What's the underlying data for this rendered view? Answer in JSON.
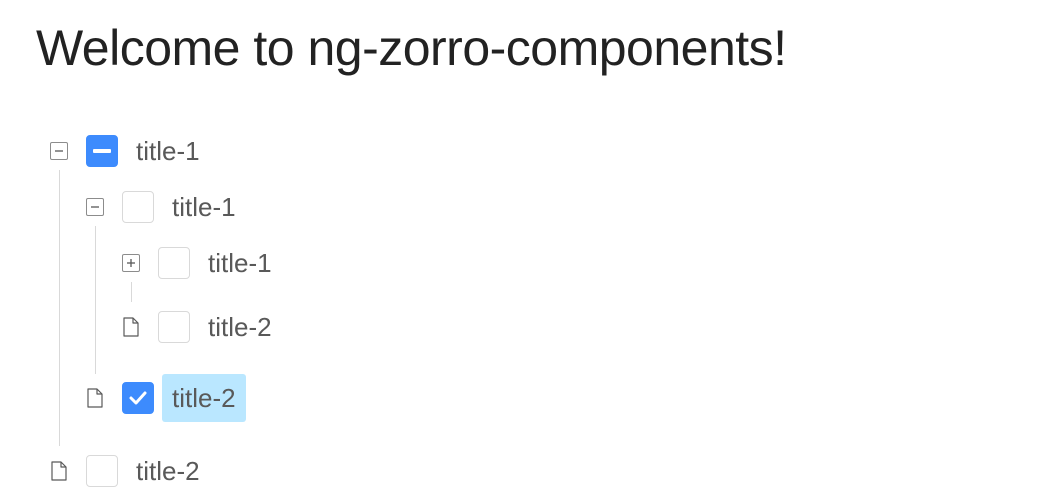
{
  "page": {
    "title": "Welcome to ng-zorro-components!"
  },
  "tree": {
    "nodes": [
      {
        "title": "title-1",
        "level": 0,
        "switcher": "minus-square-icon",
        "check": "indeterminate",
        "selected": false
      },
      {
        "title": "title-1",
        "level": 1,
        "switcher": "minus-square-icon",
        "check": "unchecked",
        "selected": false
      },
      {
        "title": "title-1",
        "level": 2,
        "switcher": "plus-square-icon",
        "check": "unchecked",
        "selected": false
      },
      {
        "title": "title-2",
        "level": 2,
        "switcher": "file-icon",
        "check": "unchecked",
        "selected": false
      },
      {
        "title": "title-2",
        "level": 1,
        "switcher": "file-icon",
        "check": "checked",
        "selected": true
      },
      {
        "title": "title-2",
        "level": 0,
        "switcher": "file-icon",
        "check": "unchecked",
        "selected": false
      }
    ]
  },
  "colors": {
    "accent": "#3d8bfd",
    "selected_background": "#bae7ff",
    "guide_line": "#d9d9d9"
  }
}
